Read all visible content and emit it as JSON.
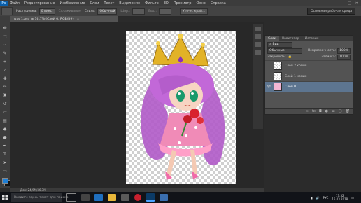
{
  "menubar": {
    "logo": "Ps",
    "items": [
      "Файл",
      "Редактирование",
      "Изображение",
      "Слои",
      "Текст",
      "Выделение",
      "Фильтр",
      "3D",
      "Просмотр",
      "Окно",
      "Справка"
    ]
  },
  "options": {
    "feather_label": "Растушевка:",
    "feather_value": "0 пикс.",
    "smoothing_label": "Сглаживание",
    "style_label": "Стиль:",
    "style_value": "Обычный",
    "width_label": "Шир.:",
    "height_label": "Выс.:",
    "refine_button": "Уточн. край...",
    "workspace": "Основная рабочая среда"
  },
  "document": {
    "tab_title": "nyxs 1.psd @ 16,7% (Слой 0, RGB/8#)",
    "status": "Док: 24,9M/46,3M"
  },
  "layers_panel": {
    "tabs": [
      "Слои",
      "Навигатор",
      "История"
    ],
    "filter_label": "Вид",
    "blend_mode": "Обычные",
    "opacity_label": "Непрозрачность:",
    "opacity_value": "100%",
    "lock_label": "Закрепить:",
    "fill_label": "Заливка:",
    "fill_value": "100%",
    "layers": [
      {
        "name": "Слой 2 копия",
        "visible": false,
        "selected": false
      },
      {
        "name": "Слой 1 копия",
        "visible": false,
        "selected": false
      },
      {
        "name": "Слой 0",
        "visible": true,
        "selected": true
      }
    ]
  },
  "taskbar": {
    "search_placeholder": "Введите здесь текст для поиска",
    "language": "РУС",
    "time": "17:52",
    "date": "15.03.2018"
  },
  "colors": {
    "accent": "#0b5ea8",
    "selected_layer": "#5d7590",
    "foreground_swatch": "#1e7fd6",
    "background_swatch": "#111111"
  }
}
